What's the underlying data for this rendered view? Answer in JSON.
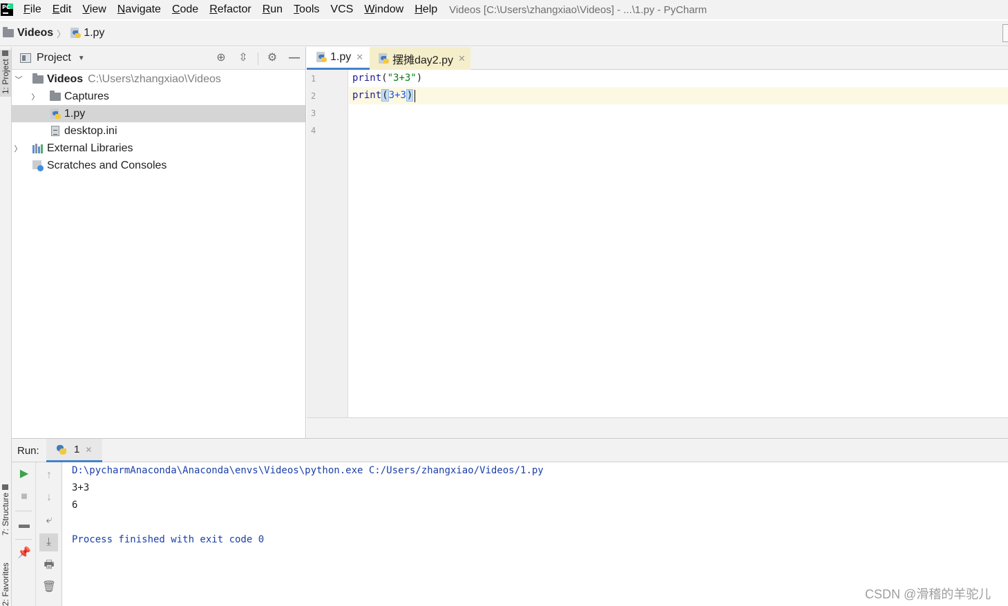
{
  "menubar": {
    "items": [
      {
        "mnemonic": "F",
        "rest": "ile"
      },
      {
        "mnemonic": "E",
        "rest": "dit"
      },
      {
        "mnemonic": "V",
        "rest": "iew"
      },
      {
        "mnemonic": "N",
        "rest": "avigate"
      },
      {
        "mnemonic": "C",
        "rest": "ode"
      },
      {
        "mnemonic": "R",
        "rest": "efactor"
      },
      {
        "mnemonic": "R",
        "rest": "un"
      },
      {
        "mnemonic": "T",
        "rest": "ools"
      },
      {
        "mnemonic": "",
        "rest": "VCS"
      },
      {
        "mnemonic": "W",
        "rest": "indow"
      },
      {
        "mnemonic": "H",
        "rest": "elp"
      }
    ],
    "window_title": "Videos [C:\\Users\\zhangxiao\\Videos] - ...\\1.py - PyCharm"
  },
  "navbar": {
    "folder": "Videos",
    "file": "1.py"
  },
  "left_stripe": {
    "project_tab": "1: Project",
    "structure_tab": "7: Structure",
    "favorites_tab": "2: Favorites"
  },
  "project_panel": {
    "title": "Project",
    "tree": [
      {
        "label": "Videos",
        "path": "C:\\Users\\zhangxiao\\Videos"
      },
      {
        "label": "Captures"
      },
      {
        "label": "1.py"
      },
      {
        "label": "desktop.ini"
      },
      {
        "label": "External Libraries"
      },
      {
        "label": "Scratches and Consoles"
      }
    ]
  },
  "editor": {
    "tabs": [
      {
        "label": "1.py"
      },
      {
        "label": "摆摊day2.py"
      }
    ],
    "line_numbers": [
      "1",
      "2",
      "3",
      "4"
    ],
    "code": {
      "line1_fn": "print",
      "line1_open": "(",
      "line1_str": "\"3+3\"",
      "line1_close": ")",
      "line2_fn": "print",
      "line2_open": "(",
      "line2_arg": "3+3",
      "line2_close": ")"
    }
  },
  "run": {
    "label": "Run:",
    "tab": "1",
    "console": [
      "D:\\pycharmAnaconda\\Anaconda\\envs\\Videos\\python.exe C:/Users/zhangxiao/Videos/1.py",
      "3+3",
      "6",
      "",
      "Process finished with exit code 0"
    ]
  },
  "watermark": "CSDN @滑稽的羊驼儿",
  "colors": {
    "accent": "#4083c9",
    "selection": "#d5d5d5",
    "current_line": "#fdf8e2",
    "tab_highlight": "#f5eeca"
  }
}
